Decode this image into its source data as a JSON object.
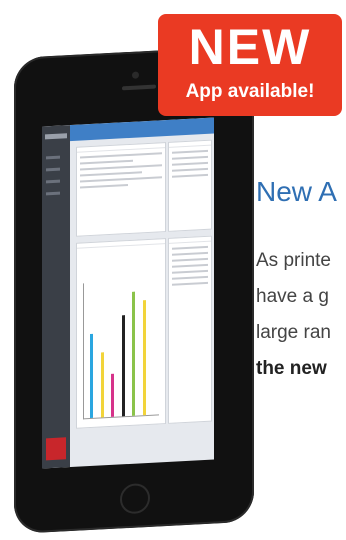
{
  "badge": {
    "title": "NEW",
    "subtitle": "App available!",
    "color": "#ea3a23"
  },
  "heading": "New A",
  "paragraph": [
    "As printe",
    "have a g",
    "large ran",
    "the new"
  ],
  "accent": "#2f6fb3",
  "phone_screen": {
    "topbar_color": "#3f7fc6",
    "sidebar_color": "#3a3f47",
    "chart_bar_colors": [
      "#2aa6e0",
      "#f2d43a",
      "#d6338a",
      "#222222",
      "#8bc34a",
      "#f2d43a"
    ],
    "chart_bar_levels": [
      0.62,
      0.48,
      0.32,
      0.75,
      0.92,
      0.85
    ]
  }
}
